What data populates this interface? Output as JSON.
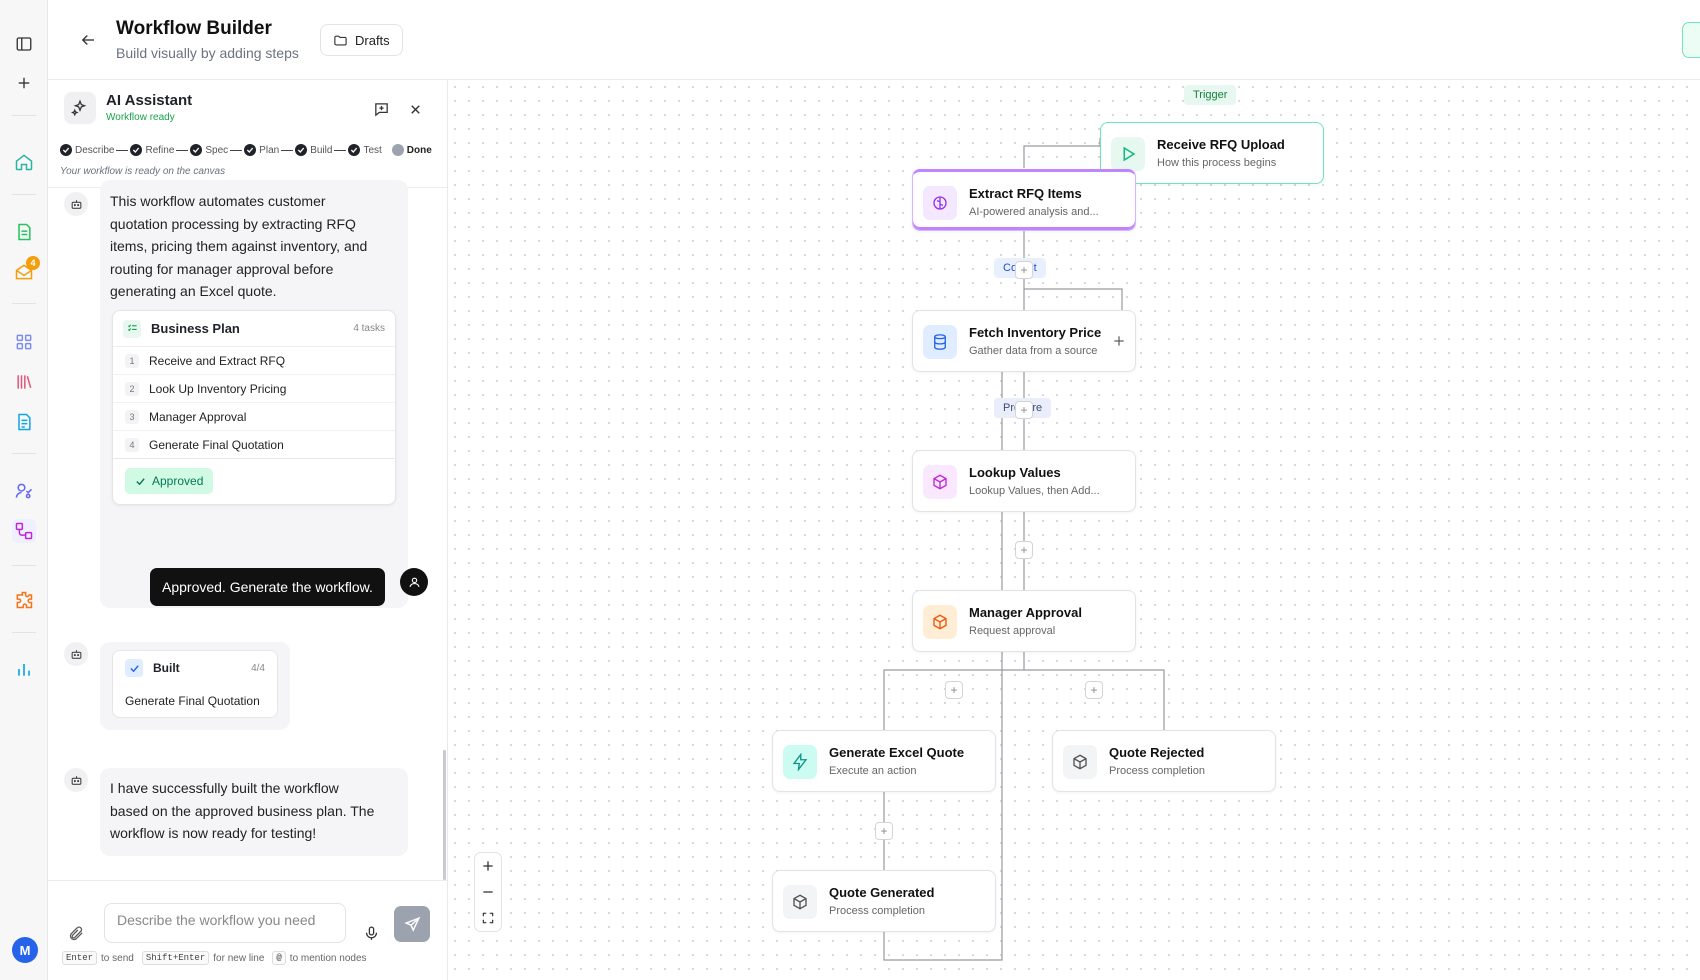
{
  "rail": {
    "avatar_initial": "M",
    "notification_count": "4"
  },
  "header": {
    "title": "Workflow Builder",
    "subtitle": "Build visually by adding steps",
    "drafts_label": "Drafts"
  },
  "assistant": {
    "title": "AI Assistant",
    "status": "Workflow ready",
    "steps": [
      "Describe",
      "Refine",
      "Spec",
      "Plan",
      "Build",
      "Test",
      "Done"
    ],
    "ready_note": "Your workflow is ready on the canvas",
    "message1": "This workflow automates customer quotation processing by extracting RFQ items, pricing them against inventory, and routing for manager approval before generating an Excel quote.",
    "plan": {
      "title": "Business Plan",
      "count": "4 tasks",
      "tasks": [
        "Receive and Extract RFQ",
        "Look Up Inventory Pricing",
        "Manager Approval",
        "Generate Final Quotation"
      ],
      "numbers": [
        "1",
        "2",
        "3",
        "4"
      ],
      "status": "Approved"
    },
    "user_message": "Approved. Generate the workflow.",
    "built": {
      "title": "Built",
      "count": "4/4",
      "item": "Generate Final Quotation"
    },
    "message2": "I have successfully built the workflow based on the approved business plan. The workflow is now ready for testing!",
    "composer": {
      "placeholder": "Describe the workflow you need",
      "hint_enter_key": "Enter",
      "hint_enter": "to send",
      "hint_shift_key": "Shift+Enter",
      "hint_shift": "for new line",
      "hint_at_key": "@",
      "hint_at": "to mention nodes"
    }
  },
  "canvas": {
    "labels": {
      "trigger": "Trigger",
      "collect": "Collect",
      "prepare": "Prepare"
    },
    "nodes": {
      "receive": {
        "title": "Receive RFQ Upload",
        "subtitle": "How this process begins",
        "icon": "play-icon"
      },
      "extract": {
        "title": "Extract RFQ Items",
        "subtitle": "AI-powered analysis and...",
        "icon": "brain-icon"
      },
      "fetch": {
        "title": "Fetch Inventory Prices",
        "subtitle": "Gather data from a source",
        "icon": "database-icon"
      },
      "lookup": {
        "title": "Lookup Values",
        "subtitle": "Lookup Values, then Add...",
        "icon": "box-icon"
      },
      "approval": {
        "title": "Manager Approval",
        "subtitle": "Request approval",
        "icon": "box-icon"
      },
      "excel": {
        "title": "Generate Excel Quote",
        "subtitle": "Execute an action",
        "icon": "bolt-icon"
      },
      "rejected": {
        "title": "Quote Rejected",
        "subtitle": "Process completion",
        "icon": "box-icon"
      },
      "generated": {
        "title": "Quote Generated",
        "subtitle": "Process completion",
        "icon": "box-icon"
      }
    },
    "plus_symbol": "+",
    "colors": {
      "trigger": "#34d399",
      "ai": "#c084fc",
      "data": "#3b82f6",
      "approval": "#f97316",
      "action": "#14b8a6"
    }
  }
}
